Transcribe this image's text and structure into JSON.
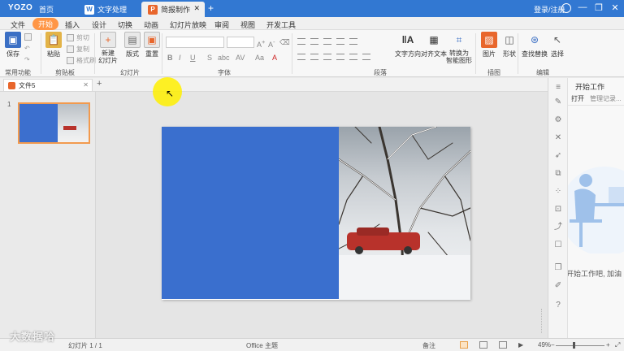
{
  "titlebar": {
    "logo": "YOZO",
    "home": "首页",
    "tabs": [
      {
        "label": "文字处理",
        "icon": "document-icon"
      },
      {
        "label": "简报制作",
        "icon": "presentation-icon"
      }
    ],
    "login": "登录/注册"
  },
  "menu": [
    "文件",
    "开始",
    "插入",
    "设计",
    "切换",
    "动画",
    "幻灯片放映",
    "审阅",
    "视图",
    "开发工具"
  ],
  "ribbon": {
    "common": {
      "save": "保存",
      "group": "常用功能"
    },
    "clipboard": {
      "paste": "粘贴",
      "cut": "剪切",
      "copy": "复制",
      "format_painter": "格式刷",
      "group": "剪贴板"
    },
    "slides": {
      "new_slide": "新建\n幻灯片",
      "layout": "版式",
      "reset": "重置",
      "group": "幻灯片"
    },
    "font": {
      "group": "字体",
      "bold": "B",
      "italic": "I",
      "underline": "U",
      "strike": "S"
    },
    "paragraph": {
      "text_direction": "文字方向",
      "align_text": "对齐文本",
      "convert_smartart": "转换为\n智能图形",
      "group": "段落"
    },
    "drawing": {
      "picture": "图片",
      "shape": "形状",
      "group": "插图"
    },
    "editing": {
      "find_replace": "查找替换",
      "select": "选择",
      "group": "编辑"
    }
  },
  "document": {
    "tab": "文件5"
  },
  "slides_panel": {
    "thumbnail_number": "1"
  },
  "taskpane": {
    "title": "开始工作",
    "open": "打开",
    "manage": "管理记录...",
    "hint": "开始工作吧, 加油"
  },
  "statusbar": {
    "slide_info": "幻灯片 1 / 1",
    "theme": "Office 主题",
    "notes": "备注",
    "zoom": "49%"
  },
  "watermark": "大数据哈",
  "colors": {
    "titlebar": "#3278d2",
    "accent": "#ff9646",
    "slide_blue": "#3a6fce"
  }
}
